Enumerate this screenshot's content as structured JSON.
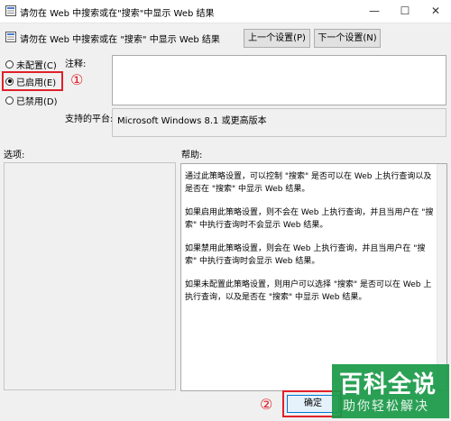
{
  "window": {
    "title": "请勿在 Web 中搜索或在\"搜索\"中显示 Web 结果",
    "minimize_glyph": "—",
    "maximize_glyph": "☐",
    "close_glyph": "✕"
  },
  "header": {
    "policy_name": "请勿在 Web 中搜索或在 \"搜索\" 中显示 Web 结果",
    "prev_button": "上一个设置(P)",
    "next_button": "下一个设置(N)"
  },
  "state_options": [
    {
      "label": "未配置(C)",
      "selected": false
    },
    {
      "label": "已启用(E)",
      "selected": true
    },
    {
      "label": "已禁用(D)",
      "selected": false
    }
  ],
  "annotations": {
    "marker_1": "①",
    "marker_2": "②",
    "highlight_color": "#e0202a"
  },
  "comment": {
    "label": "注释:",
    "value": ""
  },
  "supported_on": {
    "label": "支持的平台:",
    "value": "Microsoft Windows 8.1 或更高版本"
  },
  "options": {
    "label": "选项:"
  },
  "help": {
    "label": "帮助:",
    "paragraphs": [
      "通过此策略设置，可以控制 \"搜索\" 是否可以在 Web 上执行查询以及是否在 \"搜索\" 中显示 Web 结果。",
      "如果启用此策略设置，则不会在 Web 上执行查询，并且当用户在 \"搜索\" 中执行查询时不会显示 Web 结果。",
      "如果禁用此策略设置，则会在 Web 上执行查询，并且当用户在 \"搜索\" 中执行查询时会显示 Web 结果。",
      "如果未配置此策略设置，则用户可以选择 \"搜索\" 是否可以在 Web 上执行查询，以及是否在 \"搜索\" 中显示 Web 结果。"
    ]
  },
  "footer": {
    "ok_button": "确定"
  },
  "watermark": {
    "title": "百科全说",
    "subtitle": "助你轻松解决",
    "color": "#1a9a48"
  }
}
